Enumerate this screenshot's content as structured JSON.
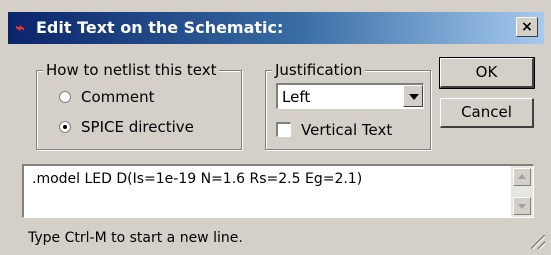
{
  "window": {
    "title": "Edit Text on the Schematic:",
    "close_label": "×"
  },
  "netlist_group": {
    "label": "How to netlist this text",
    "options": [
      {
        "label": "Comment",
        "selected": false
      },
      {
        "label": "SPICE directive",
        "selected": true
      }
    ]
  },
  "justification_group": {
    "label": "Justification",
    "selected_value": "Left",
    "vertical_text_label": "Vertical Text",
    "vertical_text_checked": false
  },
  "buttons": {
    "ok_label": "OK",
    "cancel_label": "Cancel"
  },
  "text_input": {
    "value": ".model LED D(Is=1e-19 N=1.6 Rs=2.5 Eg=2.1)"
  },
  "hint": "Type Ctrl-M to start a new line.",
  "colors": {
    "title_bar_start": "#0a246a",
    "title_bar_end": "#a6caf0",
    "dialog_face": "#d4d0c8"
  }
}
